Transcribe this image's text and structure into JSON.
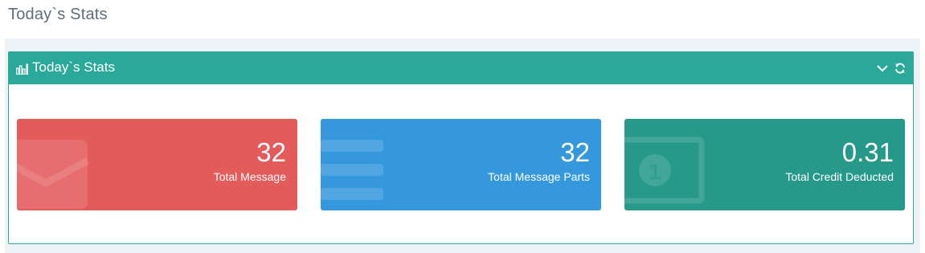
{
  "page": {
    "title": "Today`s Stats"
  },
  "portlet": {
    "title": "Today`s Stats",
    "icon": "bar-chart-icon",
    "tools": [
      "collapse-icon",
      "reload-icon"
    ],
    "header_color": "#2aa89a"
  },
  "stats": [
    {
      "number": "32",
      "label": "Total Message",
      "color": "#e35b5a",
      "icon": "envelope-icon"
    },
    {
      "number": "32",
      "label": "Total Message Parts",
      "color": "#3598dc",
      "icon": "list-icon"
    },
    {
      "number": "0.31",
      "label": "Total Credit Deducted",
      "color": "#26998a",
      "icon": "money-icon"
    }
  ]
}
